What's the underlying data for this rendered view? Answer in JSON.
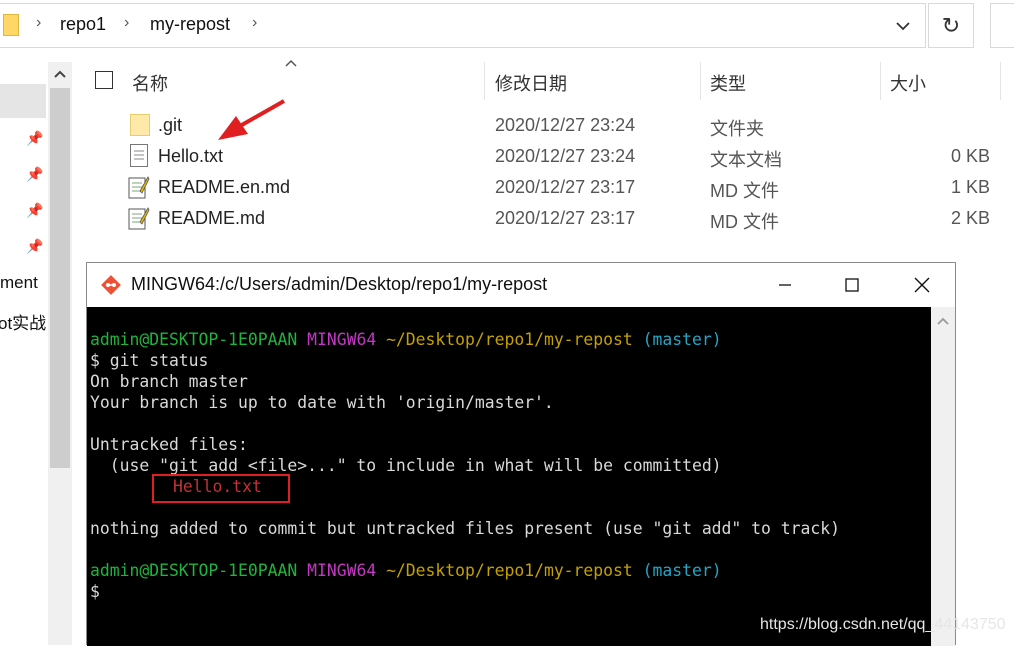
{
  "address_bar": {
    "crumbs": [
      "repo1",
      "my-repost"
    ],
    "separator": "›",
    "dropdown_icon": "chevron-down-icon",
    "refresh_icon": "refresh-icon"
  },
  "nav_pane": {
    "items": [
      "ment",
      "ot实战"
    ]
  },
  "file_list": {
    "headers": {
      "name": "名称",
      "modified": "修改日期",
      "type": "类型",
      "size": "大小"
    },
    "rows": [
      {
        "name": ".git",
        "modified": "2020/12/27 23:24",
        "type": "文件夹",
        "size": "",
        "icon": "folder-icon"
      },
      {
        "name": "Hello.txt",
        "modified": "2020/12/27 23:24",
        "type": "文本文档",
        "size": "0 KB",
        "icon": "text-file-icon"
      },
      {
        "name": "README.en.md",
        "modified": "2020/12/27 23:17",
        "type": "MD 文件",
        "size": "1 KB",
        "icon": "md-file-icon"
      },
      {
        "name": "README.md",
        "modified": "2020/12/27 23:17",
        "type": "MD 文件",
        "size": "2 KB",
        "icon": "md-file-icon"
      }
    ]
  },
  "terminal": {
    "title": "MINGW64:/c/Users/admin/Desktop/repo1/my-repost",
    "prompt1": {
      "user": "admin@DESKTOP-1E0PAAN",
      "env": "MINGW64",
      "path": "~/Desktop/repo1/my-repost",
      "branch": "(master)"
    },
    "cmd": "$ git status",
    "line_branch": "On branch master",
    "line_uptodate": "Your branch is up to date with 'origin/master'.",
    "line_untracked": "Untracked files:",
    "line_hint": "  (use \"git add <file>...\" to include in what will be committed)",
    "untracked_file": "Hello.txt",
    "line_nothing": "nothing added to commit but untracked files present (use \"git add\" to track)",
    "prompt2": {
      "user": "admin@DESKTOP-1E0PAAN",
      "env": "MINGW64",
      "path": "~/Desktop/repo1/my-repost",
      "branch": "(master)"
    },
    "cursor_line": "$",
    "colors": {
      "user": "#1db53b",
      "env": "#c436c4",
      "path": "#c4a000",
      "branch": "#25a5c5",
      "untracked": "#c53030",
      "annotation": "#e02020"
    }
  },
  "watermark": "https://blog.csdn.net/qq_44143750"
}
